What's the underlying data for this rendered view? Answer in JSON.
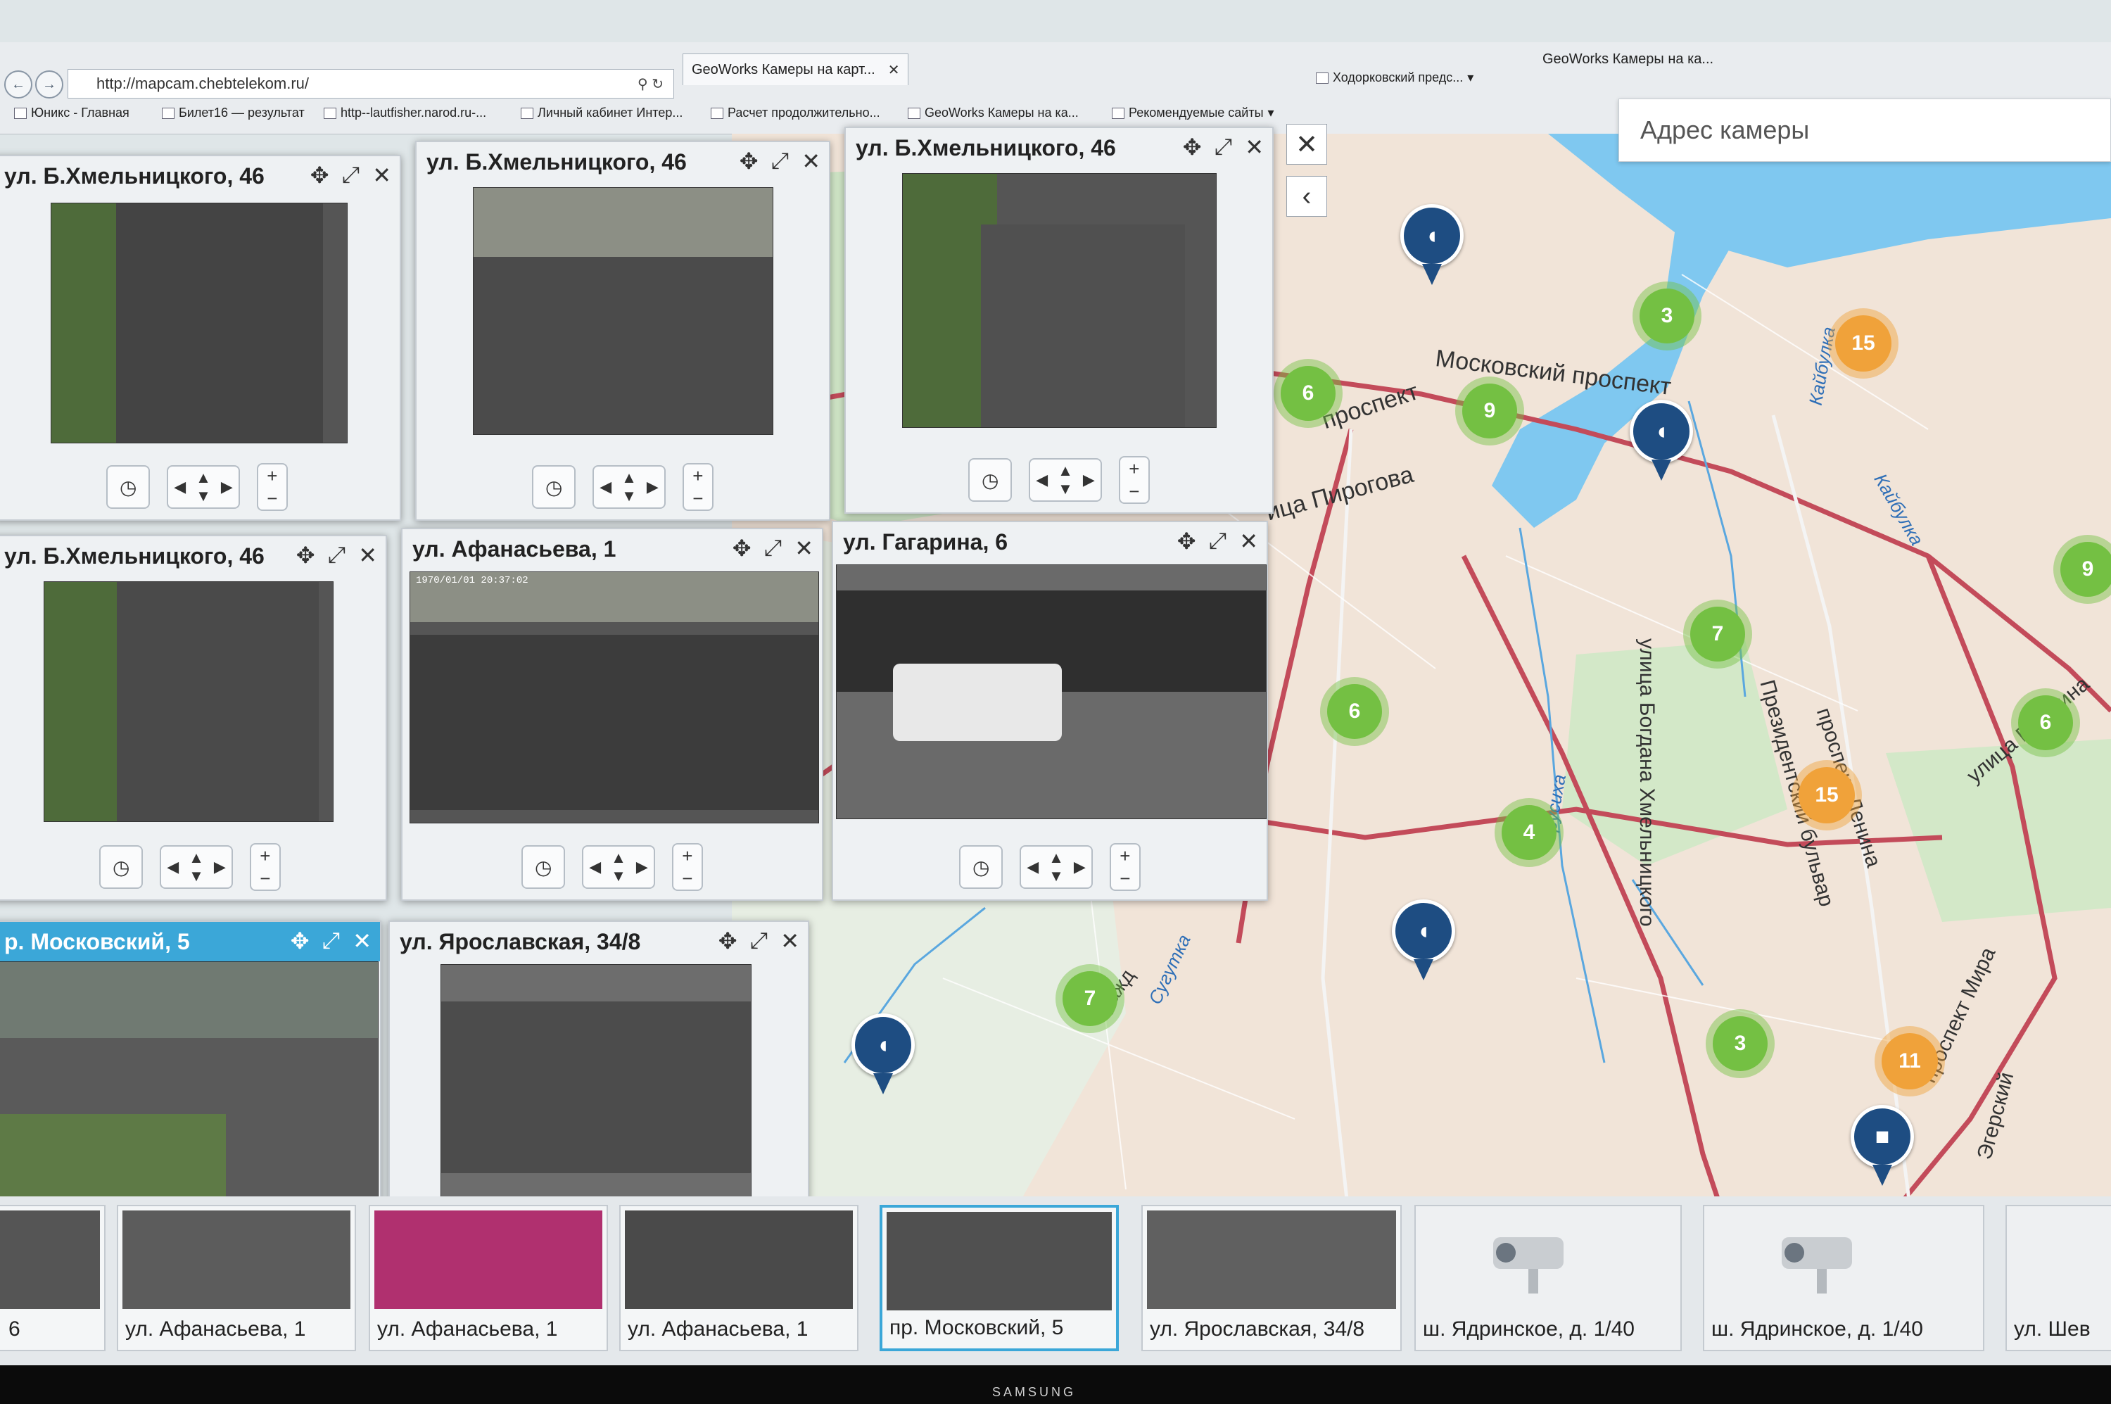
{
  "browser": {
    "address": "http://mapcam.chebtelekom.ru/",
    "tabs": [
      {
        "label": "GeoWorks Камеры на карт..."
      },
      {
        "label": "GeoWorks Камеры на ка..."
      }
    ],
    "bookmarks": [
      "Юникс - Главная",
      "Билет16 — результат",
      "http--lautfisher.narod.ru-...",
      "Личный кабинет Интер...",
      "Расчет продолжительно...",
      "GeoWorks Камеры на ка...",
      "Рекомендуемые сайты",
      "Ходорковский предс..."
    ]
  },
  "map": {
    "search_placeholder": "Адрес камеры",
    "labels": {
      "moskovsky": "Московский проспект",
      "prospekt": "проспект",
      "pirogova": "ица Пирогова",
      "hmelnitskogo": "улица Богдана Хмельницкого",
      "prezidentsky": "Президентский бульвар",
      "lenina": "проспект Ленина",
      "gagarina": "улица Гагарина",
      "mira": "проспект Мира",
      "egersky": "Эгерский",
      "grazhd": "Гражд",
      "kaiybulka1": "Кайбулка",
      "kaiybulka2": "Кайбулка",
      "sugutka": "Сугутка",
      "trukhka": "Трусиха"
    },
    "clusters": [
      {
        "id": "c3a",
        "value": "3",
        "color": "green"
      },
      {
        "id": "c15a",
        "value": "15",
        "color": "orange"
      },
      {
        "id": "c6a",
        "value": "6",
        "color": "green"
      },
      {
        "id": "c9a",
        "value": "9",
        "color": "green"
      },
      {
        "id": "c9b",
        "value": "9",
        "color": "green"
      },
      {
        "id": "c7a",
        "value": "7",
        "color": "green"
      },
      {
        "id": "c6b",
        "value": "6",
        "color": "green"
      },
      {
        "id": "c6c",
        "value": "6",
        "color": "green"
      },
      {
        "id": "c4",
        "value": "4",
        "color": "green"
      },
      {
        "id": "c15b",
        "value": "15",
        "color": "orange"
      },
      {
        "id": "c7b",
        "value": "7",
        "color": "green"
      },
      {
        "id": "c3b",
        "value": "3",
        "color": "green"
      },
      {
        "id": "c11",
        "value": "11",
        "color": "orange"
      }
    ]
  },
  "cameras": [
    {
      "title": "ул. Б.Хмельницкого, 46"
    },
    {
      "title": "ул. Б.Хмельницкого, 46"
    },
    {
      "title": "ул. Б.Хмельницкого, 46"
    },
    {
      "title": "ул. Б.Хмельницкого, 46"
    },
    {
      "title": "ул. Афанасьева, 1"
    },
    {
      "title": "ул. Гагарина, 6"
    },
    {
      "title": "р. Московский, 5"
    },
    {
      "title": "ул. Ярославская, 34/8"
    }
  ],
  "thumbnails": [
    {
      "label": "6"
    },
    {
      "label": "ул. Афанасьева, 1"
    },
    {
      "label": "ул. Афанасьева, 1"
    },
    {
      "label": "ул. Афанасьева, 1"
    },
    {
      "label": "пр. Московский, 5"
    },
    {
      "label": "ул. Ярославская, 34/8"
    },
    {
      "label": "ш. Ядринское, д. 1/40"
    },
    {
      "label": "ш. Ядринское, д. 1/40"
    },
    {
      "label": "ул. Шев"
    }
  ],
  "feed_overlay": "1970/01/01 20:37:02",
  "brand": "SAMSUNG",
  "colors": {
    "accent": "#3ba7d8",
    "cluster_green": "#74c043",
    "cluster_orange": "#f0a23a",
    "pin": "#1e4d82"
  }
}
